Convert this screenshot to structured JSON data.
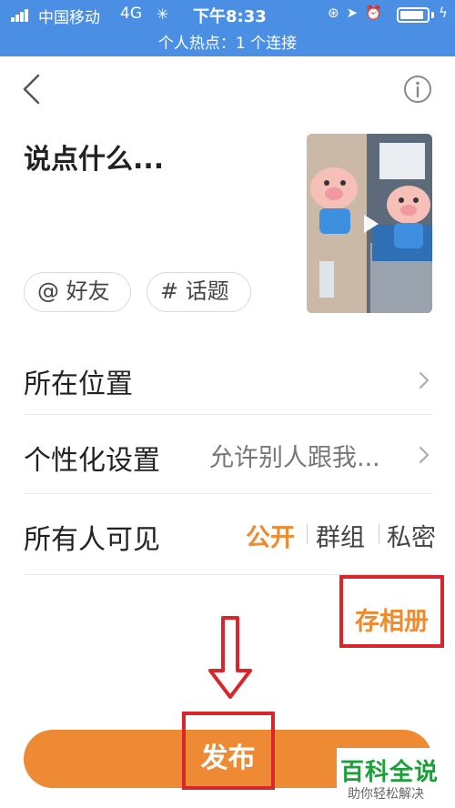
{
  "status_bar": {
    "carrier": "中国移动",
    "network": "4G",
    "time": "下午8:33",
    "hotspot_text": "个人热点：1 个连接",
    "background_color": "#4a8fe4",
    "icons": [
      "signal-icon",
      "loading-icon",
      "lock-rotation-icon",
      "location-icon",
      "alarm-icon",
      "battery-icon",
      "charging-icon"
    ],
    "battery_level": 0.9
  },
  "nav": {
    "back_icon": "chevron-left-icon",
    "info_icon": "info-icon"
  },
  "compose": {
    "placeholder": "说点什么..."
  },
  "video_thumbnail": {
    "has_play_icon": true
  },
  "chips": {
    "friends": "@ 好友",
    "topic": "# 话题"
  },
  "rows": {
    "location": {
      "label": "所在位置"
    },
    "personalization": {
      "label": "个性化设置",
      "value": "允许别人跟我..."
    },
    "visibility": {
      "label": "所有人可见",
      "options": [
        "公开",
        "群组",
        "私密"
      ],
      "selected": "公开"
    }
  },
  "save_to_album": "存相册",
  "publish_button": "发布",
  "watermark": {
    "main": "百科全说",
    "sub": "助你轻松解决"
  },
  "colors": {
    "accent": "#ef8a2e",
    "publish": "#ee8a34",
    "highlight": "#d9262d",
    "watermark": "#1e9e3a"
  }
}
